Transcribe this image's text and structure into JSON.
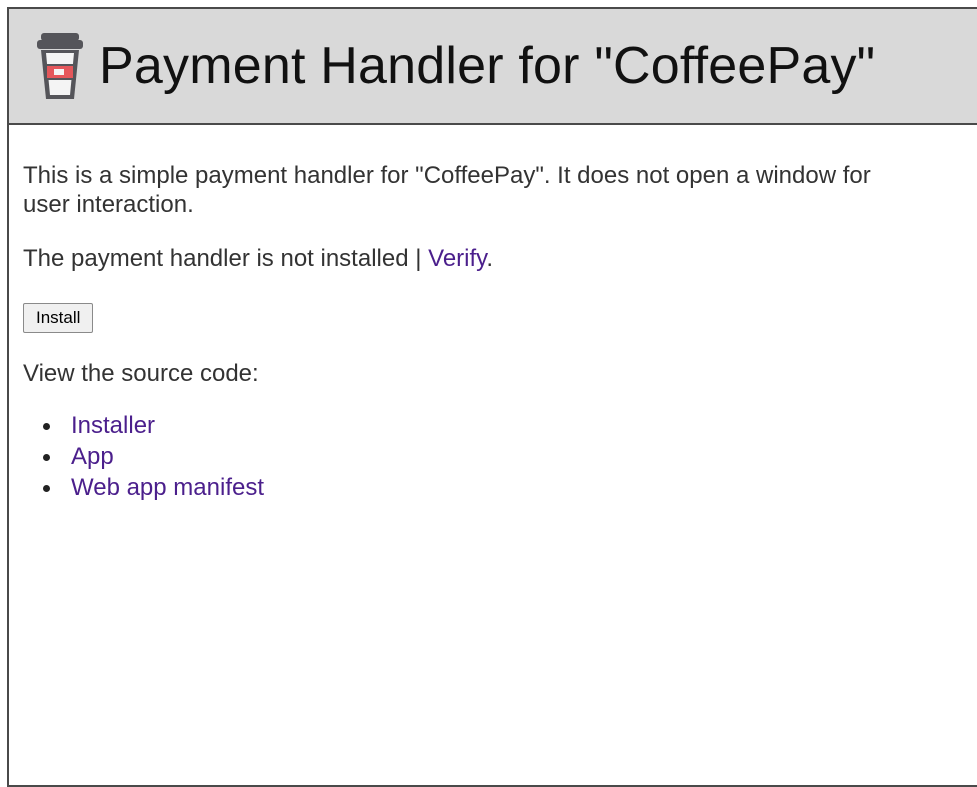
{
  "header": {
    "icon": "coffee-cup-icon",
    "title": "Payment Handler for \"CoffeePay\""
  },
  "intro": {
    "text": "This is a simple payment handler for \"CoffeePay\". It does not open a window for user interaction."
  },
  "status": {
    "text": "The payment handler is not installed | ",
    "verify_link": "Verify",
    "suffix": "."
  },
  "install_button": {
    "label": "Install"
  },
  "source": {
    "label": "View the source code:",
    "links": [
      "Installer",
      "App",
      "Web app manifest"
    ]
  },
  "colors": {
    "header_bg": "#d9d9d9",
    "link": "#4b1f8c",
    "cup_red": "#e5575b",
    "cup_gray": "#55555a"
  }
}
